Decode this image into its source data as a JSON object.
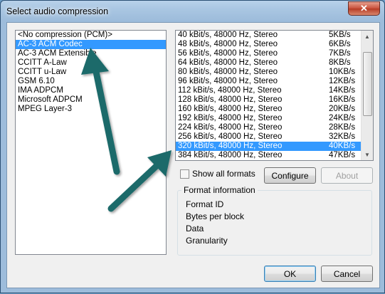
{
  "window": {
    "title": "Select audio compression",
    "close_glyph": "✕"
  },
  "codecs": [
    "<No compression (PCM)>",
    "AC-3 ACM Codec",
    "AC-3 ACM Extensible",
    "CCITT A-Law",
    "CCITT u-Law",
    "GSM 6.10",
    "IMA ADPCM",
    "Microsoft ADPCM",
    "MPEG Layer-3"
  ],
  "codec_selected_index": 1,
  "formats": [
    {
      "name": "40 kBit/s, 48000 Hz, Stereo",
      "size": "5KB/s"
    },
    {
      "name": "48 kBit/s, 48000 Hz, Stereo",
      "size": "6KB/s"
    },
    {
      "name": "56 kBit/s, 48000 Hz, Stereo",
      "size": "7KB/s"
    },
    {
      "name": "64 kBit/s, 48000 Hz, Stereo",
      "size": "8KB/s"
    },
    {
      "name": "80 kBit/s, 48000 Hz, Stereo",
      "size": "10KB/s"
    },
    {
      "name": "96 kBit/s, 48000 Hz, Stereo",
      "size": "12KB/s"
    },
    {
      "name": "112 kBit/s, 48000 Hz, Stereo",
      "size": "14KB/s"
    },
    {
      "name": "128 kBit/s, 48000 Hz, Stereo",
      "size": "16KB/s"
    },
    {
      "name": "160 kBit/s, 48000 Hz, Stereo",
      "size": "20KB/s"
    },
    {
      "name": "192 kBit/s, 48000 Hz, Stereo",
      "size": "24KB/s"
    },
    {
      "name": "224 kBit/s, 48000 Hz, Stereo",
      "size": "28KB/s"
    },
    {
      "name": "256 kBit/s, 48000 Hz, Stereo",
      "size": "32KB/s"
    },
    {
      "name": "320 kBit/s, 48000 Hz, Stereo",
      "size": "40KB/s"
    },
    {
      "name": "384 kBit/s, 48000 Hz, Stereo",
      "size": "47KB/s"
    }
  ],
  "format_selected_index": 12,
  "show_all_formats": {
    "label": "Show all formats",
    "checked": false
  },
  "buttons": {
    "configure": "Configure",
    "about": "About",
    "ok": "OK",
    "cancel": "Cancel"
  },
  "format_info": {
    "title": "Format information",
    "lines": [
      "Format ID",
      "Bytes per block",
      "Data",
      "Granularity"
    ]
  },
  "colors": {
    "selection": "#3399ff",
    "annotation_arrow": "#1e6b6b"
  }
}
